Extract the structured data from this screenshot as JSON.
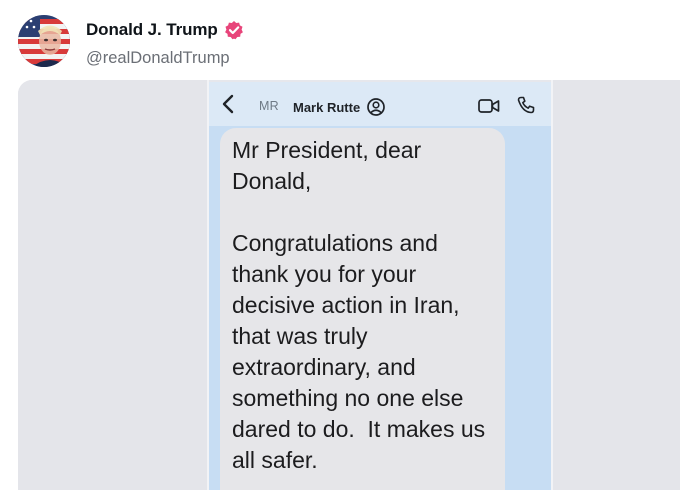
{
  "post": {
    "display_name": "Donald J. Trump",
    "handle": "@realDonaldTrump",
    "avatar_icon": "flag-portrait-avatar",
    "verified_icon": "verified-badge-icon",
    "verified_color": "#e8447a"
  },
  "attachment": {
    "chat_header": {
      "back_icon": "chevron-left-icon",
      "contact_initials": "MR",
      "contact_name": "Mark Rutte",
      "contact_icon": "contact-info-icon",
      "video_icon": "video-camera-icon",
      "call_icon": "phone-icon"
    },
    "message": {
      "text": "Mr President, dear\nDonald,\n\nCongratulations and\nthank you for your\ndecisive action in Iran,\nthat was truly\nextraordinary, and\nsomething no one else\ndared to do.  It makes us\nall safer."
    }
  },
  "colors": {
    "chat_background": "#c7ddf3",
    "bubble_background": "#e6e6e9"
  }
}
